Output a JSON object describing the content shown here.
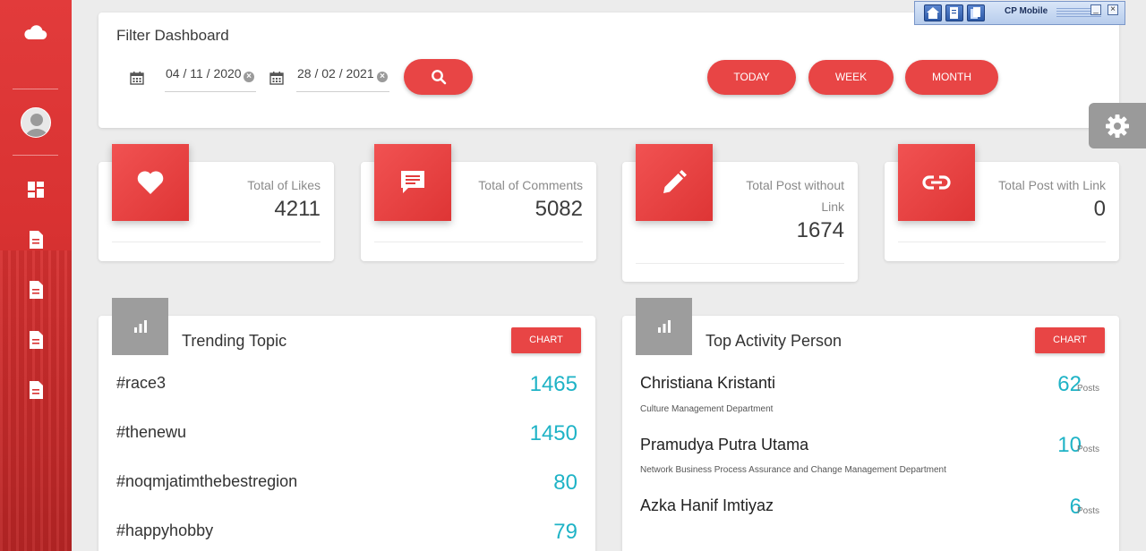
{
  "filter": {
    "title": "Filter Dashboard",
    "start_date": "04 / 11 / 2020",
    "end_date": "28 / 02 / 2021",
    "ranges": [
      "TODAY",
      "WEEK",
      "MONTH"
    ]
  },
  "stats": [
    {
      "label_line1": "Total of Likes",
      "label_line2": "",
      "value": "4211",
      "icon": "heart-icon"
    },
    {
      "label_line1": "Total of Comments",
      "label_line2": "",
      "value": "5082",
      "icon": "comment-icon"
    },
    {
      "label_line1": "Total Post without",
      "label_line2": "Link",
      "value": "1674",
      "icon": "pencil-icon"
    },
    {
      "label_line1": "Total Post with Link",
      "label_line2": "",
      "value": "0",
      "icon": "link-icon"
    }
  ],
  "trending": {
    "title": "Trending Topic",
    "chart_label": "CHART",
    "items": [
      {
        "topic": "#race3",
        "count": "1465"
      },
      {
        "topic": "#thenewu",
        "count": "1450"
      },
      {
        "topic": "#noqmjatimthebestregion",
        "count": "80"
      },
      {
        "topic": "#happyhobby",
        "count": "79"
      }
    ]
  },
  "activity": {
    "title": "Top Activity Person",
    "chart_label": "CHART",
    "people": [
      {
        "name": "Christiana Kristanti",
        "department": "Culture Management Department",
        "count": "62",
        "unit": "Posts"
      },
      {
        "name": "Pramudya Putra Utama",
        "department": "Network Business Process Assurance and Change Management Department",
        "count": "10",
        "unit": "Posts"
      },
      {
        "name": "Azka Hanif Imtiyaz",
        "department": "",
        "count": "6",
        "unit": "Posts"
      }
    ]
  },
  "toolbar": {
    "title": "CP Mobile"
  },
  "colors": {
    "accent": "#e84545",
    "teal": "#1fb3c6",
    "sidebar": "#d93232"
  }
}
